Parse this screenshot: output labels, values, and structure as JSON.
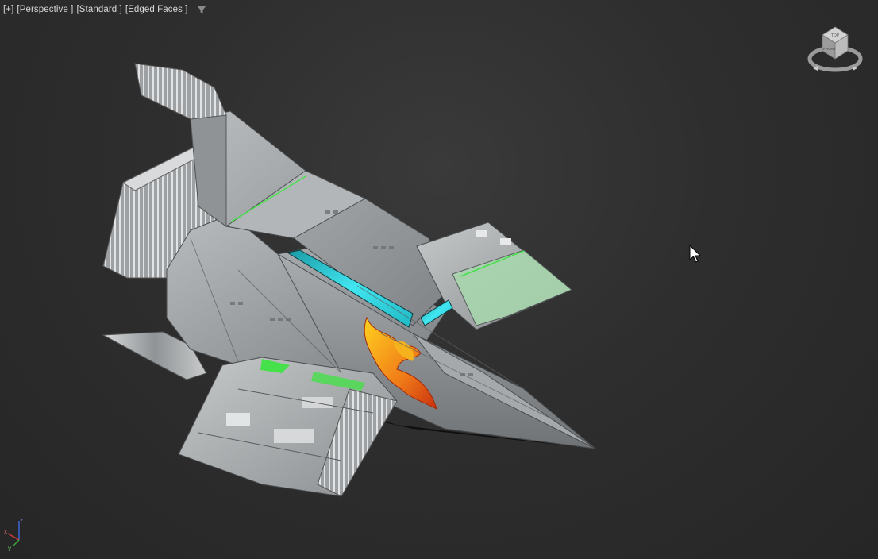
{
  "viewport": {
    "labels": {
      "plus_menu": "[+]",
      "view": "[Perspective ]",
      "shading": "[Standard ]",
      "display": "[Edged Faces ]"
    },
    "filter_icon": "filter-funnel-icon",
    "viewcube": {
      "icon": "viewcube-icon",
      "top_label": "TOP",
      "front_label": "FRONT"
    },
    "axis_tripod": {
      "x": "x",
      "y": "y",
      "z": "z"
    },
    "model": "spaceship-model",
    "colors": {
      "background": "#2e2e2e",
      "hull": "#9a9d9f",
      "cockpit_glass": "#2fd6e0",
      "edge_highlight": "#46e04a",
      "emblem": "#f08a1c"
    }
  }
}
